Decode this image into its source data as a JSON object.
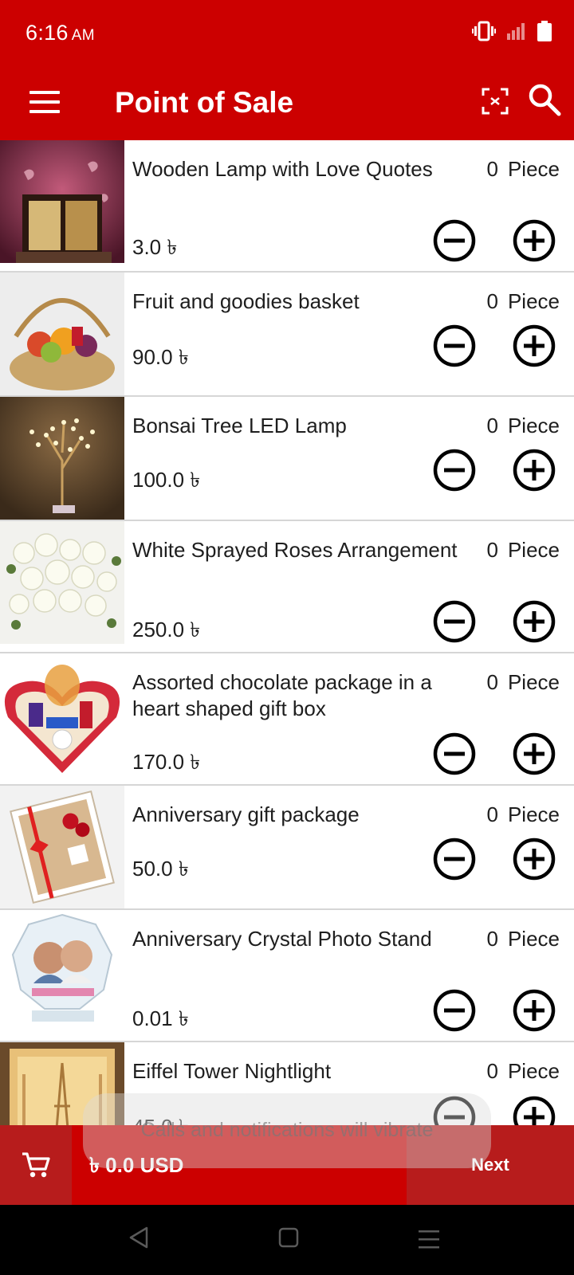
{
  "status_bar": {
    "time": "6:16",
    "ampm": "AM",
    "icons": [
      "vibrate-icon",
      "signal-icon",
      "battery-icon"
    ]
  },
  "app_bar": {
    "title": "Point of Sale",
    "icons": [
      "menu-icon",
      "scan-icon",
      "search-icon"
    ]
  },
  "products": [
    {
      "name": "Wooden Lamp with Love Quotes",
      "quantity": "0",
      "unit": "Piece",
      "price": "3.0 ৳"
    },
    {
      "name": "Fruit and goodies basket",
      "quantity": "0",
      "unit": "Piece",
      "price": "90.0 ৳"
    },
    {
      "name": "Bonsai Tree LED Lamp",
      "quantity": "0",
      "unit": "Piece",
      "price": "100.0 ৳"
    },
    {
      "name": "White Sprayed Roses Arrangement",
      "quantity": "0",
      "unit": "Piece",
      "price": "250.0 ৳"
    },
    {
      "name": "Assorted chocolate package in a heart shaped gift box",
      "quantity": "0",
      "unit": "Piece",
      "price": "170.0 ৳"
    },
    {
      "name": "Anniversary gift package",
      "quantity": "0",
      "unit": "Piece",
      "price": "50.0 ৳"
    },
    {
      "name": "Anniversary Crystal Photo Stand",
      "quantity": "0",
      "unit": "Piece",
      "price": "0.01 ৳"
    },
    {
      "name": "Eiffel Tower Nightlight",
      "quantity": "0",
      "unit": "Piece",
      "price": "45.0 ৳"
    }
  ],
  "cart": {
    "total": "৳ 0.0 USD",
    "next_label": "Next"
  },
  "toast": {
    "message": "Calls and notifications will vibrate"
  },
  "colors": {
    "primary": "#cc0000",
    "primary_dark": "#b71c1c",
    "divider": "#d6d6d6"
  }
}
